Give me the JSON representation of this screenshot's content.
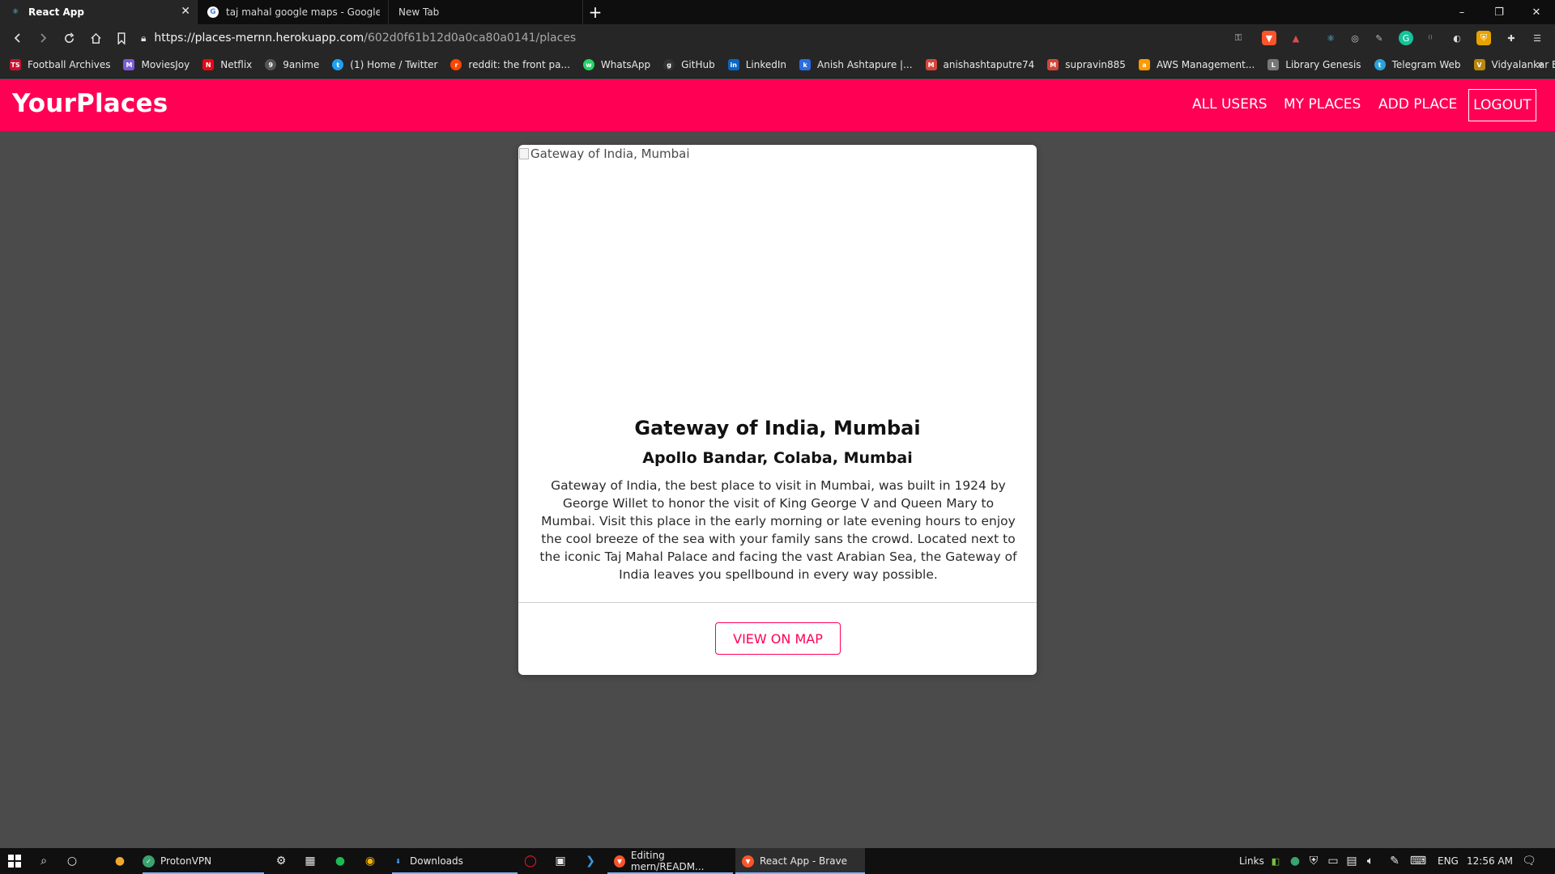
{
  "browser": {
    "tabs": [
      {
        "title": "React App",
        "active": true
      },
      {
        "title": "taj mahal google maps - Google Searc",
        "active": false
      },
      {
        "title": "New Tab",
        "active": false
      }
    ],
    "new_tab_label": "+",
    "window_controls": {
      "minimize": "–",
      "restore": "❐",
      "close": "✕"
    },
    "url_host": "https://places-mernn.herokuapp.com",
    "url_path": "/602d0f61b12d0a0ca80a0141/places",
    "bookmarks": [
      {
        "label": "Football Archives",
        "icon": "TS",
        "color": "#c8102e"
      },
      {
        "label": "MoviesJoy",
        "icon": "M",
        "color": "#7b5cd6"
      },
      {
        "label": "Netflix",
        "icon": "N",
        "color": "#e50914"
      },
      {
        "label": "9anime",
        "icon": "9",
        "color": "#555555"
      },
      {
        "label": "(1) Home / Twitter",
        "icon": "t",
        "color": "#1da1f2"
      },
      {
        "label": "reddit: the front pa...",
        "icon": "r",
        "color": "#ff4500"
      },
      {
        "label": "WhatsApp",
        "icon": "w",
        "color": "#25d366"
      },
      {
        "label": "GitHub",
        "icon": "g",
        "color": "#333333"
      },
      {
        "label": "LinkedIn",
        "icon": "in",
        "color": "#0a66c2"
      },
      {
        "label": "Anish Ashtapure |...",
        "icon": "k",
        "color": "#2a6de0"
      },
      {
        "label": "anishashtaputre74",
        "icon": "M",
        "color": "#d44638"
      },
      {
        "label": "supravin885",
        "icon": "M",
        "color": "#d44638"
      },
      {
        "label": "AWS Management...",
        "icon": "a",
        "color": "#ff9900"
      },
      {
        "label": "Library Genesis",
        "icon": "L",
        "color": "#777777"
      },
      {
        "label": "Telegram Web",
        "icon": "t",
        "color": "#2aa1da"
      },
      {
        "label": "Vidyalankar ERP Sys...",
        "icon": "V",
        "color": "#b8860b"
      }
    ],
    "bookmarks_more": "»"
  },
  "app": {
    "brand": "YourPlaces",
    "nav": {
      "all_users": "ALL USERS",
      "my_places": "MY PLACES",
      "add_place": "ADD PLACE",
      "logout": "LOGOUT"
    },
    "place": {
      "image_alt": "Gateway of India, Mumbai",
      "title": "Gateway of India, Mumbai",
      "address": "Apollo Bandar, Colaba, Mumbai",
      "description": "Gateway of India, the best place to visit in Mumbai, was built in 1924 by George Willet to honor the visit of King George V and Queen Mary to Mumbai. Visit this place in the early morning or late evening hours to enjoy the cool breeze of the sea with your family sans the crowd. Located next to the iconic Taj Mahal Palace and facing the vast Arabian Sea, the Gateway of India leaves you spellbound in every way possible.",
      "view_on_map": "VIEW ON MAP"
    },
    "colors": {
      "accent": "#ff0055",
      "background": "#4b4b4b"
    }
  },
  "taskbar": {
    "apps": [
      {
        "label": "ProtonVPN"
      },
      {
        "label": "Downloads"
      },
      {
        "label": "Editing mern/READM..."
      },
      {
        "label": "React App - Brave"
      }
    ],
    "tray": {
      "links": "Links",
      "language": "ENG",
      "time": "12:56 AM"
    }
  }
}
